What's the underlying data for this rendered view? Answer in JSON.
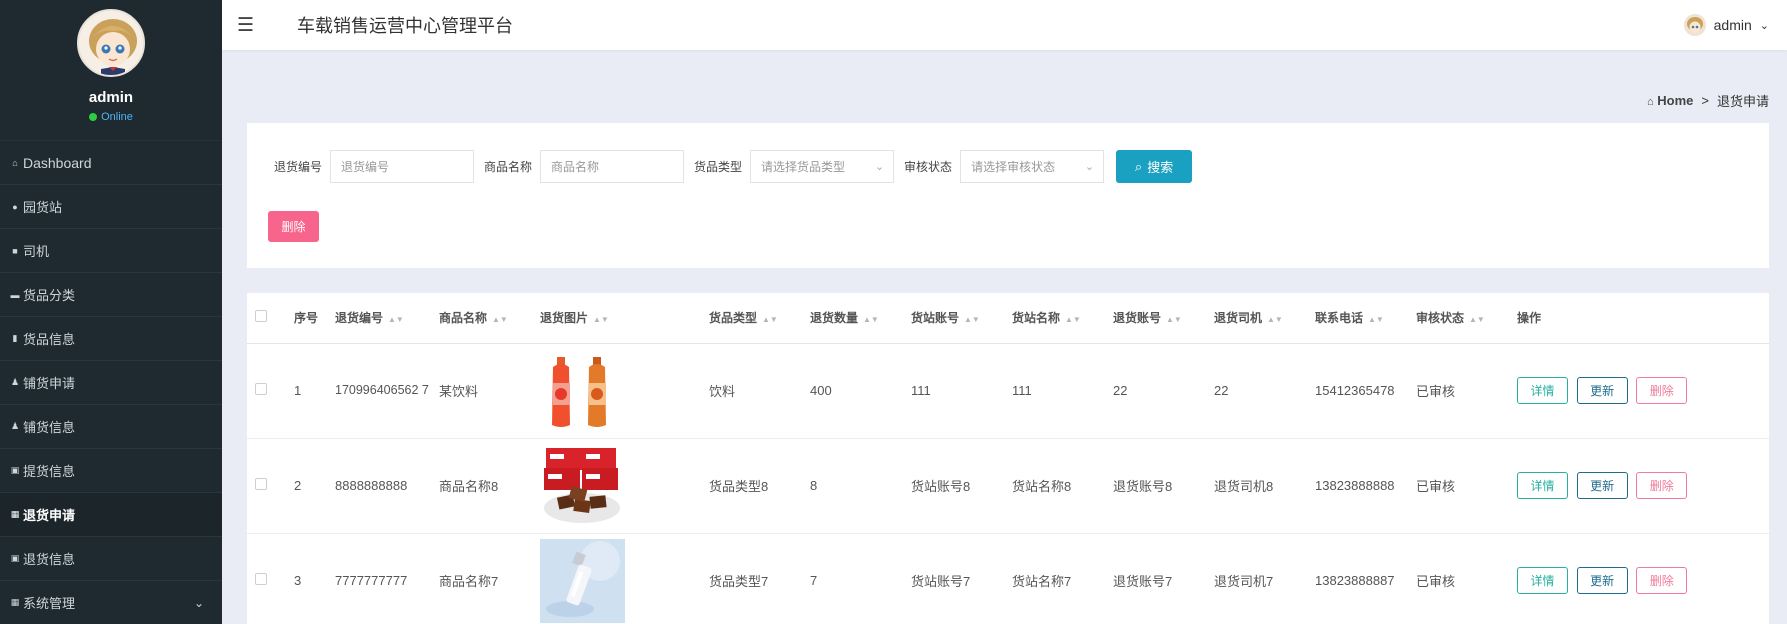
{
  "app_title": "车载销售运营中心管理平台",
  "user": {
    "name": "admin",
    "status": "Online"
  },
  "header": {
    "username": "admin"
  },
  "sidebar": {
    "items": [
      {
        "label": "Dashboard",
        "icon": "home-icon"
      },
      {
        "label": "园货站",
        "icon": "map-pin-icon"
      },
      {
        "label": "司机",
        "icon": "chat-icon"
      },
      {
        "label": "货品分类",
        "icon": "folder-icon"
      },
      {
        "label": "货品信息",
        "icon": "chart-icon"
      },
      {
        "label": "铺货申请",
        "icon": "user-icon"
      },
      {
        "label": "铺货信息",
        "icon": "user-icon"
      },
      {
        "label": "提货信息",
        "icon": "clipboard-icon"
      },
      {
        "label": "退货申请",
        "icon": "grid-icon",
        "active": true
      },
      {
        "label": "退货信息",
        "icon": "clipboard-icon"
      },
      {
        "label": "系统管理",
        "icon": "grid-icon"
      }
    ]
  },
  "breadcrumb": {
    "home": "Home",
    "separator": ">",
    "current": "退货申请"
  },
  "search": {
    "fields": [
      {
        "label": "退货编号",
        "placeholder": "退货编号"
      },
      {
        "label": "商品名称",
        "placeholder": "商品名称"
      },
      {
        "label": "货品类型",
        "placeholder": "请选择货品类型"
      },
      {
        "label": "审核状态",
        "placeholder": "请选择审核状态"
      }
    ],
    "search_label": "搜索",
    "delete_label": "删除"
  },
  "table": {
    "columns": [
      "序号",
      "退货编号",
      "商品名称",
      "退货图片",
      "货品类型",
      "退货数量",
      "货站账号",
      "货站名称",
      "退货账号",
      "退货司机",
      "联系电话",
      "审核状态",
      "操作"
    ],
    "rows": [
      {
        "index": "1",
        "code": "170996406562 7",
        "name": "某饮料",
        "type": "饮料",
        "qty": "400",
        "station_acc": "111",
        "station_name": "111",
        "return_acc": "22",
        "driver": "22",
        "phone": "15412365478",
        "status": "已审核"
      },
      {
        "index": "2",
        "code": "8888888888",
        "name": "商品名称8",
        "type": "货品类型8",
        "qty": "8",
        "station_acc": "货站账号8",
        "station_name": "货站名称8",
        "return_acc": "退货账号8",
        "driver": "退货司机8",
        "phone": "13823888888",
        "status": "已审核"
      },
      {
        "index": "3",
        "code": "7777777777",
        "name": "商品名称7",
        "type": "货品类型7",
        "qty": "7",
        "station_acc": "货站账号7",
        "station_name": "货站名称7",
        "return_acc": "退货账号7",
        "driver": "退货司机7",
        "phone": "13823888887",
        "status": "已审核"
      }
    ],
    "actions": {
      "detail": "详情",
      "update": "更新",
      "delete": "删除"
    }
  },
  "colors": {
    "sidebar_bg": "#1f2a30",
    "search_button": "#1aa0c0",
    "delete_button": "#f7648c",
    "page_bg": "#e9ecf4"
  }
}
